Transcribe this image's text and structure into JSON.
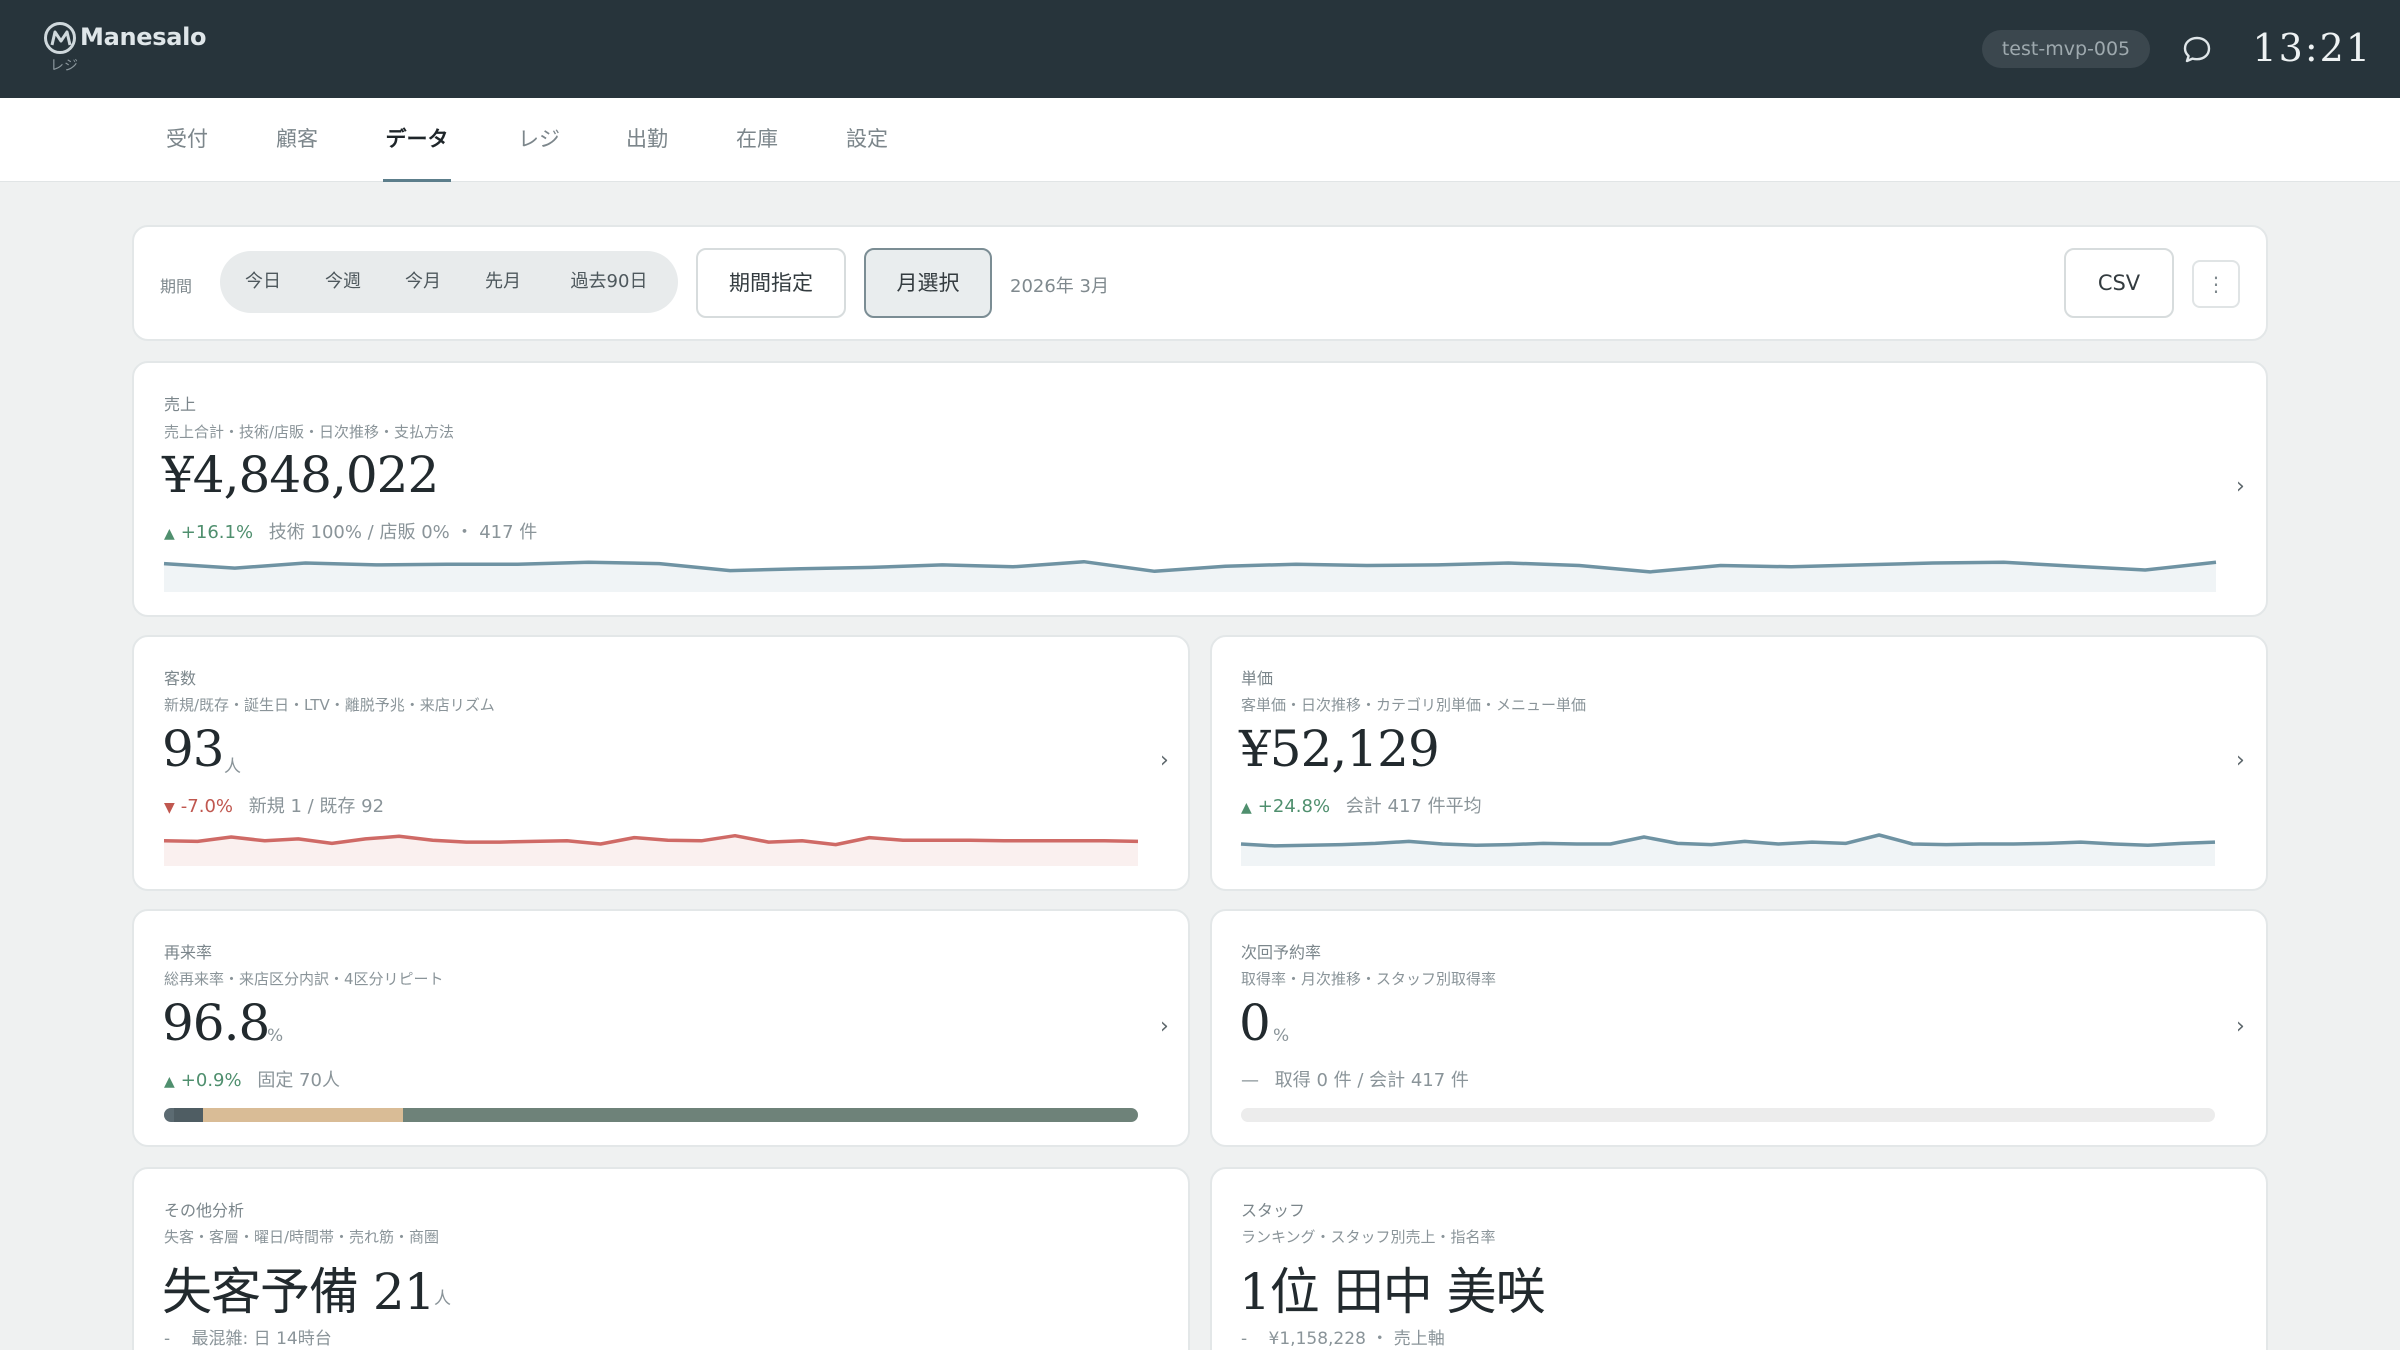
{
  "header": {
    "brand": "Manesalo",
    "brand_sub": "レジ",
    "account": "test-mvp-005",
    "time": "13:21"
  },
  "nav": {
    "tabs": [
      "受付",
      "顧客",
      "データ",
      "レジ",
      "出勤",
      "在庫",
      "設定"
    ],
    "active": "データ"
  },
  "filter": {
    "label": "期間",
    "periods": [
      "今日",
      "今週",
      "今月",
      "先月",
      "過去90日"
    ],
    "range_button": "期間指定",
    "month_button": "月選択",
    "selected_month": "2026年 3月",
    "csv_button": "CSV",
    "more_button": "⋮"
  },
  "colors": {
    "accent": "#5c7e8b",
    "positive": "#4f8f6e",
    "negative": "#c0574f",
    "spark_blue": "#6f93a3",
    "spark_red": "#cf6a66"
  },
  "metrics": {
    "sales": {
      "title": "売上",
      "subtitle": "売上合計・技術/店販・日次推移・支払方法",
      "value": "¥4,848,022",
      "delta": "+16.1%",
      "detail": "技術 100% / 店販 0% ・ 417 件",
      "trend": [
        70,
        56,
        72,
        66,
        68,
        68,
        74,
        70,
        48,
        54,
        58,
        66,
        60,
        76,
        46,
        62,
        68,
        64,
        66,
        72,
        64,
        44,
        64,
        60,
        66,
        72,
        74,
        62,
        50,
        74
      ]
    },
    "customers": {
      "title": "客数",
      "subtitle": "新規/既存・誕生日・LTV・離脱予兆・来店リズム",
      "value": "93",
      "unit": "人",
      "delta": "-7.0%",
      "detail": "新規 1 / 既存 92",
      "trend": [
        60,
        58,
        72,
        60,
        66,
        52,
        66,
        74,
        62,
        56,
        56,
        58,
        60,
        50,
        70,
        62,
        60,
        76,
        56,
        60,
        48,
        70,
        62,
        62,
        62,
        60,
        60,
        60,
        60,
        58
      ]
    },
    "unit_price": {
      "title": "単価",
      "subtitle": "客単価・日次推移・カテゴリ別単価・メニュー単価",
      "value": "¥52,129",
      "delta": "+24.8%",
      "detail": "会計 417 件平均",
      "trend": [
        50,
        44,
        46,
        48,
        52,
        58,
        50,
        46,
        48,
        52,
        50,
        50,
        72,
        52,
        48,
        58,
        50,
        56,
        52,
        78,
        50,
        48,
        50,
        50,
        52,
        56,
        50,
        46,
        52,
        56
      ]
    },
    "return_rate": {
      "title": "再来率",
      "subtitle": "総再来率・来店区分内訳・4区分リピート",
      "value": "96.8",
      "unit": "%",
      "delta": "+0.9%",
      "detail": "固定 70人",
      "breakdown": [
        {
          "share": 1.0,
          "color": "#5c6b72"
        },
        {
          "share": 3.0,
          "color": "#4f5d63"
        },
        {
          "share": 20.5,
          "color": "#d9bc96"
        },
        {
          "share": 75.5,
          "color": "#6e8279"
        }
      ]
    },
    "next_booking": {
      "title": "次回予約率",
      "subtitle": "取得率・月次推移・スタッフ別取得率",
      "value": "0",
      "unit": "%",
      "delta": "—",
      "detail": "取得 0 件 / 会計 417 件",
      "progress": 0
    },
    "other": {
      "title": "その他分析",
      "subtitle": "失客・客層・曜日/時間帯・売れ筋・商圏",
      "value": "失客予備 21",
      "unit": "人",
      "delta": "-",
      "detail": "最混雑: 日 14時台"
    },
    "staff": {
      "title": "スタッフ",
      "subtitle": "ランキング・スタッフ別売上・指名率",
      "value": "1位 田中 美咲",
      "delta": "-",
      "detail": "¥1,158,228 ・ 売上軸"
    }
  }
}
